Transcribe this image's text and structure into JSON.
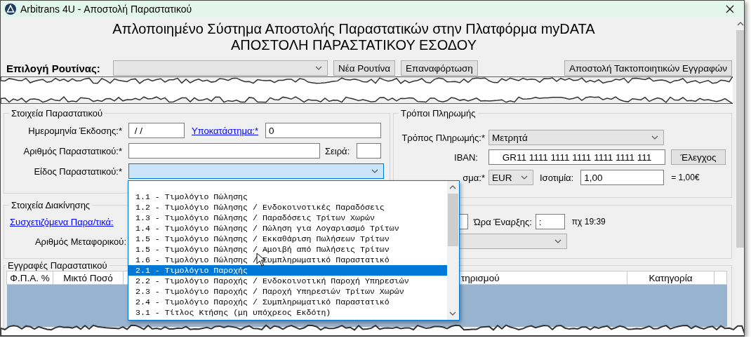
{
  "window": {
    "title": "Arbitrans 4U - Αποστολή Παραστατικού"
  },
  "header": {
    "title": "Απλοποιημένο Σύστημα Αποστολής Παραστατικών στην Πλατφόρμα myDATA",
    "subtitle": "ΑΠΟΣΤΟΛΗ ΠΑΡΑΣΤΑΤΙΚΟΥ ΕΣΟΔΟΥ"
  },
  "routine": {
    "label": "Επιλογή Ρουτίνας:",
    "buttons": [
      "Νέα Ρουτίνα",
      "Επαναφόρτωση",
      "Αποστολή Τακτοποιητικών Εγγραφών"
    ]
  },
  "document": {
    "title": "Στοιχεία Παραστατικού",
    "issue_date_label": "Ημερομηνία Έκδοσης:*",
    "issue_date": " / /",
    "branch_link": "Υποκατάστημα:*",
    "branch": "0",
    "number_label": "Αριθμός Παραστατικού:*",
    "series_label": "Σειρά:",
    "type_label": "Είδος Παραστατικού:*"
  },
  "payment": {
    "title": "Τρόποι Πληρωμής",
    "method_label": "Τρόπος Πληρωμής:*",
    "method": "Μετρητά",
    "iban_label": "IBAN:",
    "iban": "GR11 1111 1111 1111 1111 1111 111",
    "check_button": "Έλεγχος",
    "currency_label": "σμα:*",
    "currency": "EUR",
    "rate_label": "Ισοτιμία:",
    "rate": "1,00",
    "rate_result": "= 1,00€"
  },
  "transport": {
    "title": "Στοιχεία Διακίνησης",
    "related_link": "Συσχετιζόμενα Παρα/τικά:",
    "carrier_label": "Αριθμός Μεταφορικού:",
    "start_time_label": "Ώρα Έναρξης:",
    "start_time": ":",
    "hint": "πχ 19:39"
  },
  "entries": {
    "title": "Εγγραφές Παραστατικού",
    "columns": [
      "Φ.Π.Α. %",
      "Μικτό Ποσό",
      "τηρισμού",
      "Κατηγορία"
    ]
  },
  "type_dropdown": {
    "items": [
      {
        "label": "1.1 - Τιμολόγιο Πώλησης",
        "selected": false
      },
      {
        "label": "1.2 - Τιμολόγιο Πώλησης / Ενδοκοινοτικές Παραδόσεις",
        "selected": false
      },
      {
        "label": "1.3 - Τιμολόγιο Πώλησης / Παραδόσεις Τρίτων Χωρών",
        "selected": false
      },
      {
        "label": "1.4 - Τιμολόγιο Πώλησης / Πώληση για Λογαριασμό Τρίτων",
        "selected": false
      },
      {
        "label": "1.5 - Τιμολόγιο Πώλησης / Εκκαθάριση Πωλήσεων Τρίτων",
        "selected": false
      },
      {
        "label": "1.5 - Τιμολόγιο Πώλησης / Αμοιβή από Πωλήσεις Τρίτων",
        "selected": false
      },
      {
        "label": "1.6 - Τιμολόγιο Πώλησης / Συμπληρωματικό Παραστατικό",
        "selected": false
      },
      {
        "label": "2.1 - Τιμολόγιο Παροχής",
        "selected": true
      },
      {
        "label": "2.2 - Τιμολόγιο Παροχής / Ενδοκοινοτική Παροχή Υπηρεσιών",
        "selected": false
      },
      {
        "label": "2.3 - Τιμολόγιο Παροχής / Παροχή Υπηρεσιών Τρίτων Χωρών",
        "selected": false
      },
      {
        "label": "2.4 - Τιμολόγιο Παροχής / Συμπληρωματικό Παραστατικό",
        "selected": false
      },
      {
        "label": "3.1 - Τίτλος Κτήσης (μη υπόχρεος Εκδότη)",
        "selected": false
      }
    ]
  }
}
